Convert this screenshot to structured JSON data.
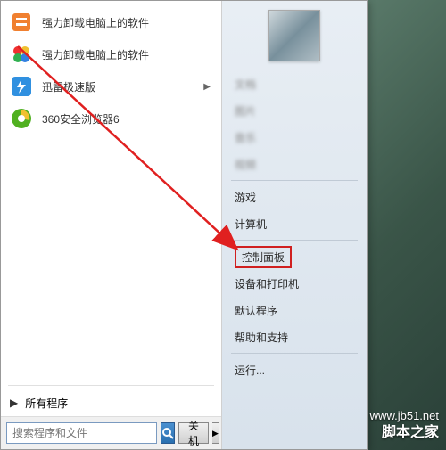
{
  "programs": [
    {
      "label": "强力卸载电脑上的软件",
      "icon": "uninstall",
      "color": "#f08030"
    },
    {
      "label": "强力卸载电脑上的软件",
      "icon": "clover",
      "color": "#f0c030"
    },
    {
      "label": "迅雷极速版",
      "icon": "thunder",
      "color": "#3090e0",
      "hasSub": true
    },
    {
      "label": "360安全浏览器6",
      "icon": "browser",
      "color": "#50b020"
    }
  ],
  "allPrograms": "所有程序",
  "search": {
    "placeholder": "搜索程序和文件"
  },
  "shutdown": {
    "label": "关机"
  },
  "rightItems": [
    {
      "label": "文档",
      "blur": true
    },
    {
      "label": "图片",
      "blur": true
    },
    {
      "label": "音乐",
      "blur": true
    },
    {
      "label": "视频",
      "blur": true
    },
    {
      "label": "游戏",
      "blur": false,
      "sepBefore": true
    },
    {
      "label": "计算机",
      "blur": false
    },
    {
      "label": "控制面板",
      "blur": false,
      "highlight": true,
      "sepBefore": true
    },
    {
      "label": "设备和打印机",
      "blur": false
    },
    {
      "label": "默认程序",
      "blur": false
    },
    {
      "label": "帮助和支持",
      "blur": false
    },
    {
      "label": "运行...",
      "blur": false,
      "sepBefore": true
    }
  ],
  "watermark": {
    "url": "www.jb51.net",
    "name": "脚本之家"
  }
}
